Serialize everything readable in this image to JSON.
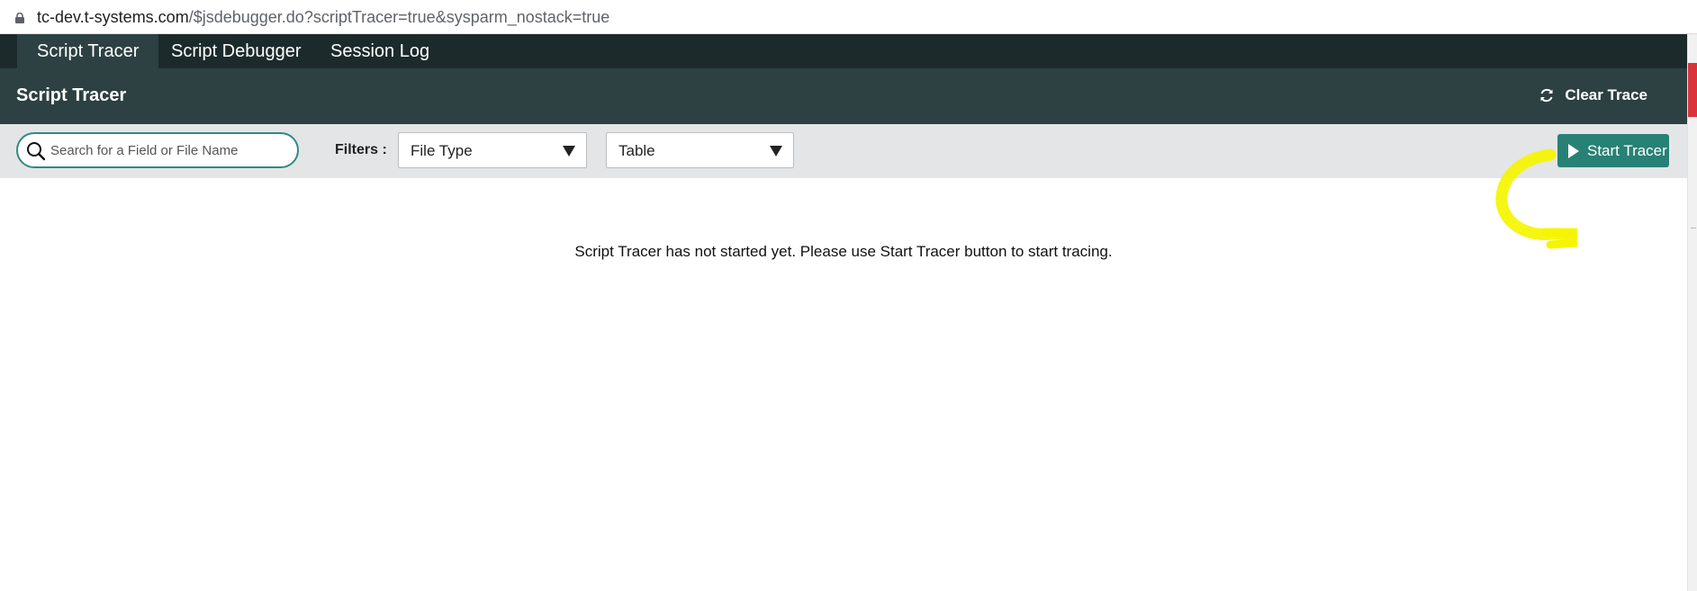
{
  "browser": {
    "url_host": "tc-dev.t-systems.com",
    "url_path": "/$jsdebugger.do?scriptTracer=true&sysparm_nostack=true"
  },
  "tabs": [
    {
      "label": "Script Tracer",
      "active": true
    },
    {
      "label": "Script Debugger",
      "active": false
    },
    {
      "label": "Session Log",
      "active": false
    }
  ],
  "header": {
    "title": "Script Tracer",
    "clear_label": "Clear Trace"
  },
  "filters": {
    "search_placeholder": "Search for a Field or File Name",
    "label": "Filters :",
    "file_type": "File Type",
    "table": "Table"
  },
  "actions": {
    "start_label": "Start Tracer"
  },
  "main": {
    "message": "Script Tracer has not started yet. Please use Start Tracer button to start tracing."
  },
  "colors": {
    "tabbar": "#1c2a2c",
    "header": "#2d4042",
    "accent": "#278174",
    "filterbar": "#e4e5e7",
    "highlight": "#f5f500"
  },
  "icons": [
    "lock-icon",
    "refresh-icon",
    "search-icon",
    "chevron-down-icon",
    "play-icon"
  ]
}
